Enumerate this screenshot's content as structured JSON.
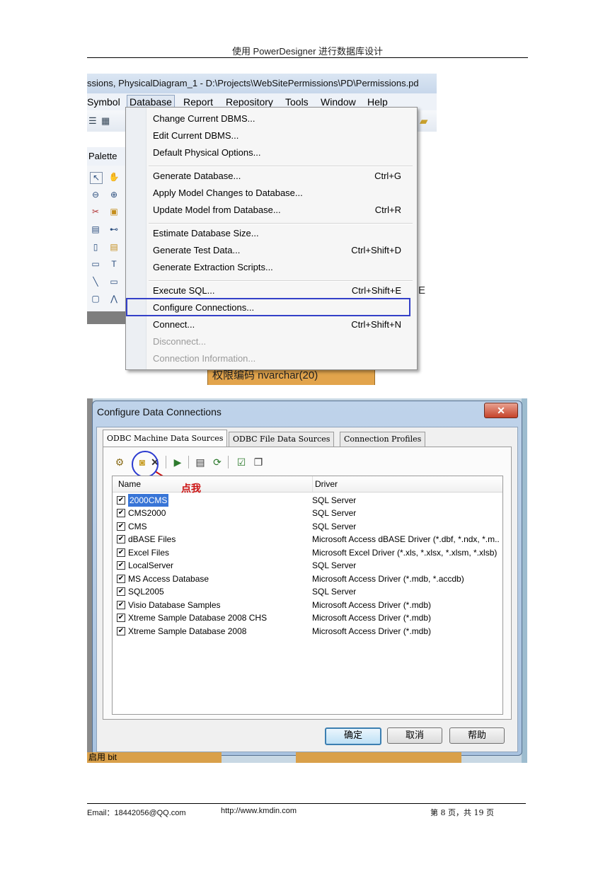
{
  "page_header": {
    "title": "使用 PowerDesigner 进行数据库设计"
  },
  "page_footer": {
    "email": "Email：18442056@QQ.com",
    "url": "http://www.kmdin.com",
    "page_info": "第 8 页，共 19 页"
  },
  "screenshot1": {
    "window_title": "ssions, PhysicalDiagram_1 - D:\\Projects\\WebSitePermissions\\PD\\Permissions.pd",
    "menu": [
      "Symbol",
      "Database",
      "Report",
      "Repository",
      "Tools",
      "Window",
      "Help"
    ],
    "palette_title": "Palette",
    "dropdown": [
      {
        "label": "Change Current DBMS...",
        "shortcut": ""
      },
      {
        "label": "Edit Current DBMS...",
        "shortcut": ""
      },
      {
        "label": "Default Physical Options...",
        "shortcut": ""
      },
      {
        "label": "Generate Database...",
        "shortcut": "Ctrl+G"
      },
      {
        "label": "Apply Model Changes to Database...",
        "shortcut": ""
      },
      {
        "label": "Update Model from Database...",
        "shortcut": "Ctrl+R"
      },
      {
        "label": "Estimate Database Size...",
        "shortcut": ""
      },
      {
        "label": "Generate Test Data...",
        "shortcut": "Ctrl+Shift+D"
      },
      {
        "label": "Generate Extraction Scripts...",
        "shortcut": ""
      },
      {
        "label": "Execute SQL...",
        "shortcut": "Ctrl+Shift+E"
      },
      {
        "label": "Configure Connections...",
        "shortcut": ""
      },
      {
        "label": "Connect...",
        "shortcut": "Ctrl+Shift+N"
      },
      {
        "label": "Disconnect...",
        "shortcut": ""
      },
      {
        "label": "Connection Information...",
        "shortcut": ""
      }
    ],
    "entity_text": "权限编码 nvarchar(20)",
    "edge_text": "E"
  },
  "screenshot2": {
    "dialog_title": "Configure Data Connections",
    "close_symbol": "✕",
    "tabs": [
      "ODBC Machine Data Sources",
      "ODBC File Data Sources",
      "Connection Profiles"
    ],
    "annotation": "点我",
    "columns": {
      "name": "Name",
      "driver": "Driver"
    },
    "rows": [
      {
        "name": "2000CMS",
        "driver": "SQL Server"
      },
      {
        "name": "CMS2000",
        "driver": "SQL Server"
      },
      {
        "name": "CMS",
        "driver": "SQL Server"
      },
      {
        "name": "dBASE Files",
        "driver": "Microsoft Access dBASE Driver (*.dbf, *.ndx, *.m..."
      },
      {
        "name": "Excel Files",
        "driver": "Microsoft Excel Driver (*.xls, *.xlsx, *.xlsm, *.xlsb)"
      },
      {
        "name": "LocalServer",
        "driver": "SQL Server"
      },
      {
        "name": "MS Access Database",
        "driver": "Microsoft Access Driver (*.mdb, *.accdb)"
      },
      {
        "name": "SQL2005",
        "driver": "SQL Server"
      },
      {
        "name": "Visio Database Samples",
        "driver": "Microsoft Access Driver (*.mdb)"
      },
      {
        "name": "Xtreme Sample Database 2008 CHS",
        "driver": "Microsoft Access Driver (*.mdb)"
      },
      {
        "name": "Xtreme Sample Database 2008",
        "driver": "Microsoft Access Driver (*.mdb)"
      }
    ],
    "buttons": {
      "ok": "确定",
      "cancel": "取消",
      "help": "帮助"
    },
    "bottom_fragment": "启用 bit"
  }
}
